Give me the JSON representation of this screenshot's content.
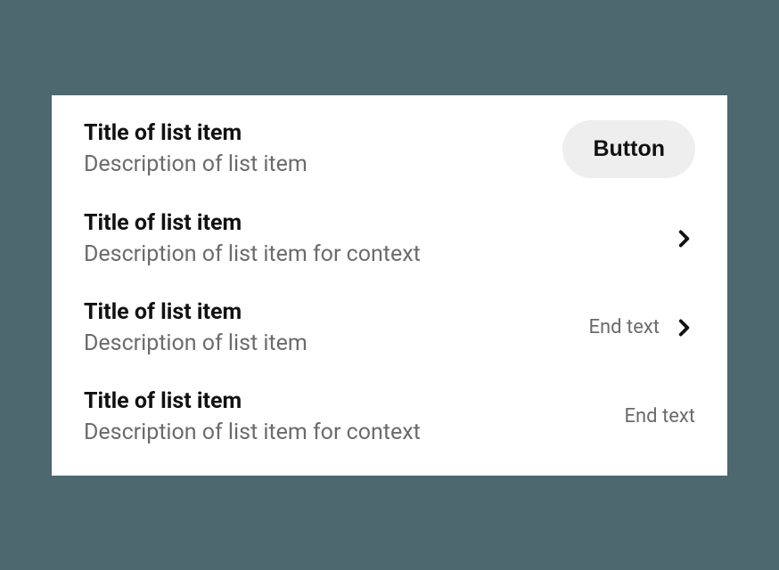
{
  "list": {
    "items": [
      {
        "title": "Title of list item",
        "description": "Description of list item",
        "button_label": "Button"
      },
      {
        "title": "Title of list item",
        "description": "Description of list item for context"
      },
      {
        "title": "Title of list item",
        "description": "Description of list item",
        "end_text": "End text"
      },
      {
        "title": "Title of list item",
        "description": "Description of list item for context",
        "end_text": "End text"
      }
    ]
  }
}
